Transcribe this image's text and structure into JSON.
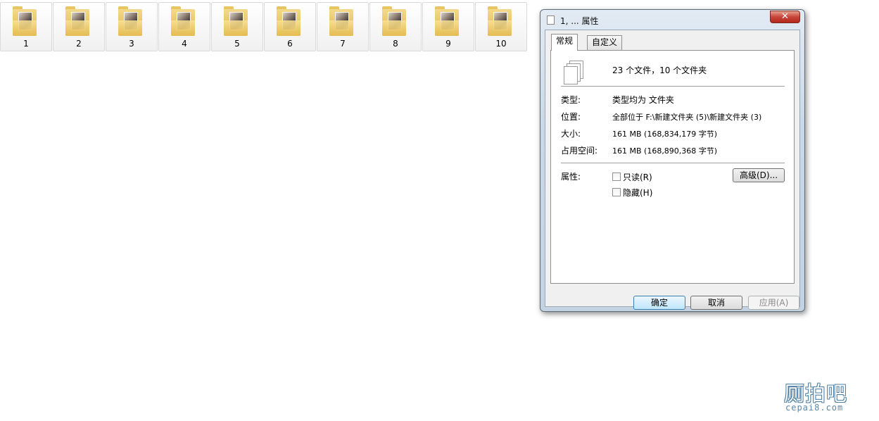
{
  "folders": [
    {
      "name": "1"
    },
    {
      "name": "2"
    },
    {
      "name": "3"
    },
    {
      "name": "4"
    },
    {
      "name": "5"
    },
    {
      "name": "6"
    },
    {
      "name": "7"
    },
    {
      "name": "8"
    },
    {
      "name": "9"
    },
    {
      "name": "10"
    }
  ],
  "dialog": {
    "title": "1, ... 属性",
    "close_glyph": "✕",
    "tabs": [
      {
        "label": "常规",
        "selected": true
      },
      {
        "label": "自定义",
        "selected": false
      }
    ],
    "summary": "23 个文件，10 个文件夹",
    "fields": {
      "type_label": "类型:",
      "type_value": "类型均为 文件夹",
      "location_label": "位置:",
      "location_value": "全部位于 F:\\新建文件夹 (5)\\新建文件夹 (3)",
      "size_label": "大小:",
      "size_value": "161 MB (168,834,179 字节)",
      "disk_label": "占用空间:",
      "disk_value": "161 MB (168,890,368 字节)"
    },
    "attributes": {
      "label": "属性:",
      "readonly_label": "只读(R)",
      "readonly_checked": false,
      "hidden_label": "隐藏(H)",
      "hidden_checked": false,
      "advanced_label": "高级(D)..."
    },
    "buttons": {
      "ok": "确定",
      "cancel": "取消",
      "apply": "应用(A)"
    }
  },
  "watermark": {
    "chinese": "厕拍吧",
    "url": "cepai8.com"
  },
  "icons": {
    "folder": "folder-icon",
    "files": "files-icon",
    "close": "close-icon"
  }
}
